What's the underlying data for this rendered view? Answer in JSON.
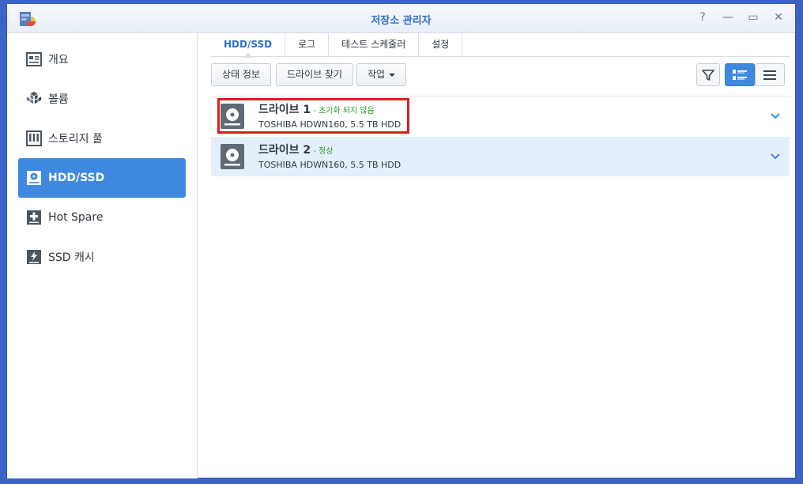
{
  "window": {
    "title": "저장소 관리자"
  },
  "controls": {
    "help": "?",
    "minimize": "—",
    "maximize": "▭",
    "close": "✕"
  },
  "sidebar": {
    "items": [
      {
        "label": "개요",
        "icon": "overview-icon"
      },
      {
        "label": "볼륨",
        "icon": "volume-icon"
      },
      {
        "label": "스토리지 풀",
        "icon": "storage-pool-icon"
      },
      {
        "label": "HDD/SSD",
        "icon": "hdd-icon",
        "active": true
      },
      {
        "label": "Hot Spare",
        "icon": "hot-spare-icon"
      },
      {
        "label": "SSD 캐시",
        "icon": "ssd-cache-icon"
      }
    ]
  },
  "tabs": [
    {
      "label": "HDD/SSD",
      "active": true
    },
    {
      "label": "로그"
    },
    {
      "label": "테스트 스케줄러"
    },
    {
      "label": "설정"
    }
  ],
  "toolbar": {
    "status_info": "상태 정보",
    "find_drive": "드라이브 찾기",
    "action": "작업"
  },
  "drives": [
    {
      "name": "드라이브 1",
      "status": " - 초기화 되지 않음",
      "desc": "TOSHIBA HDWN160, 5.5 TB HDD"
    },
    {
      "name": "드라이브 2",
      "status": " - 정상",
      "desc": "TOSHIBA HDWN160, 5.5 TB HDD"
    }
  ],
  "colors": {
    "accent": "#3f88e0",
    "status_green": "#2c9a2c",
    "highlight_red": "#e01b1b"
  }
}
